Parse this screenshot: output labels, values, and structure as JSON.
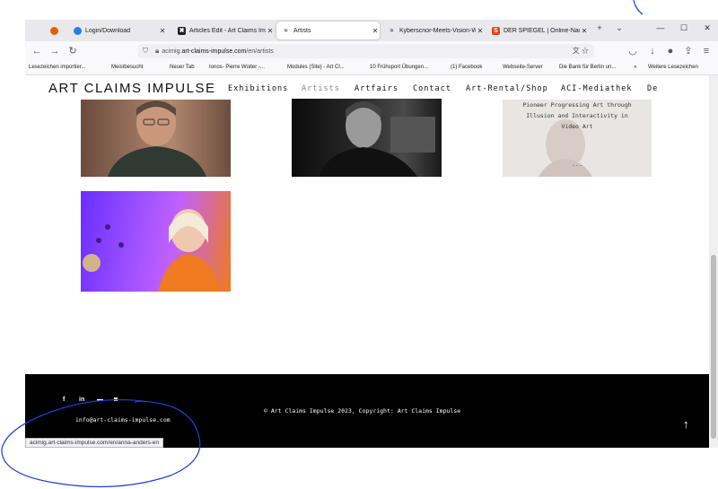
{
  "browser": {
    "tabs": [
      {
        "label": "Login/Download",
        "icon": "firefox-icon"
      },
      {
        "label": "Articles Edit - Art Claims Im",
        "icon": "joomla-icon"
      },
      {
        "label": "Artists",
        "icon": "aci-icon"
      },
      {
        "label": "Kyberscnor-Meets-Vision-W",
        "icon": "aci-icon"
      },
      {
        "label": "DER SPIEGEL | Online-Nachr",
        "icon": "spiegel-icon"
      }
    ],
    "url_prefix": "acimig.",
    "url_domain": "art-claims-impulse.com",
    "url_path": "/en/artists",
    "bookmarks": [
      "Lesezeichen importier...",
      "Meistbesucht",
      "Neuer Tab",
      "Ionos- Pierre Woiter -...",
      "Modules (Site) - Art Cl...",
      "10 Frühsport Übungen...",
      "(1) Facebook",
      "Webseite-Server",
      "Die Bank für Berlin un...",
      "»",
      "Weitere Lesezeichen"
    ],
    "status_url": "acimig.art-claims-impulse.com/en/anna-anders-en"
  },
  "site": {
    "logo": "ART CLAIMS IMPULSE",
    "menu": [
      "Exhibitions",
      "Artists",
      "Artfairs",
      "Contact",
      "Art-Rental/Shop",
      "ACI-Mediathek",
      "De"
    ],
    "photo3_text": [
      "Pioneer Progressing Art through",
      "Illusion and Interactivity in",
      "Video Art"
    ],
    "photo3_ellipsis": "...",
    "footer_email": "info@art-claims-impulse.com",
    "footer_copyright": "© Art Claims Impulse 2023, Copyright: Art Claims Impulse",
    "social": [
      "f",
      "in",
      "yt",
      "ig"
    ]
  },
  "colors": {
    "footer_bg": "#000000",
    "annotation_pen": "#1c3fd6",
    "menu_active": "#888888"
  }
}
